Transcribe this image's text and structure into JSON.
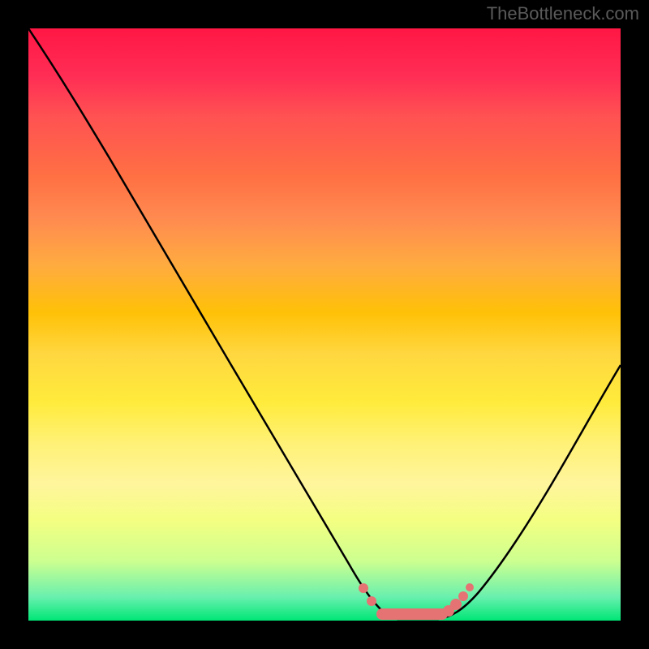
{
  "watermark": "TheBottleneck.com",
  "colors": {
    "background": "#000000",
    "gradient_top": "#ff1744",
    "gradient_bottom": "#00e676",
    "curve": "#000000",
    "highlight": "#e57373"
  },
  "chart_data": {
    "type": "line",
    "title": "",
    "xlabel": "",
    "ylabel": "",
    "xlim": [
      0,
      100
    ],
    "ylim": [
      0,
      100
    ],
    "x": [
      0,
      5,
      10,
      15,
      20,
      25,
      30,
      35,
      40,
      45,
      50,
      55,
      58,
      60,
      63,
      66,
      70,
      75,
      80,
      85,
      90,
      95,
      100
    ],
    "values": [
      100,
      93,
      85,
      77,
      68,
      59,
      50,
      41,
      32,
      23,
      14,
      6,
      2,
      0,
      0,
      0,
      0,
      1,
      5,
      12,
      21,
      31,
      42
    ],
    "highlight_region": {
      "x_start": 55,
      "x_end": 72,
      "description": "optimal zone markers near minimum"
    },
    "notes": "V-shaped bottleneck curve over rainbow gradient; minimum near x≈65; no axis tick labels visible"
  }
}
